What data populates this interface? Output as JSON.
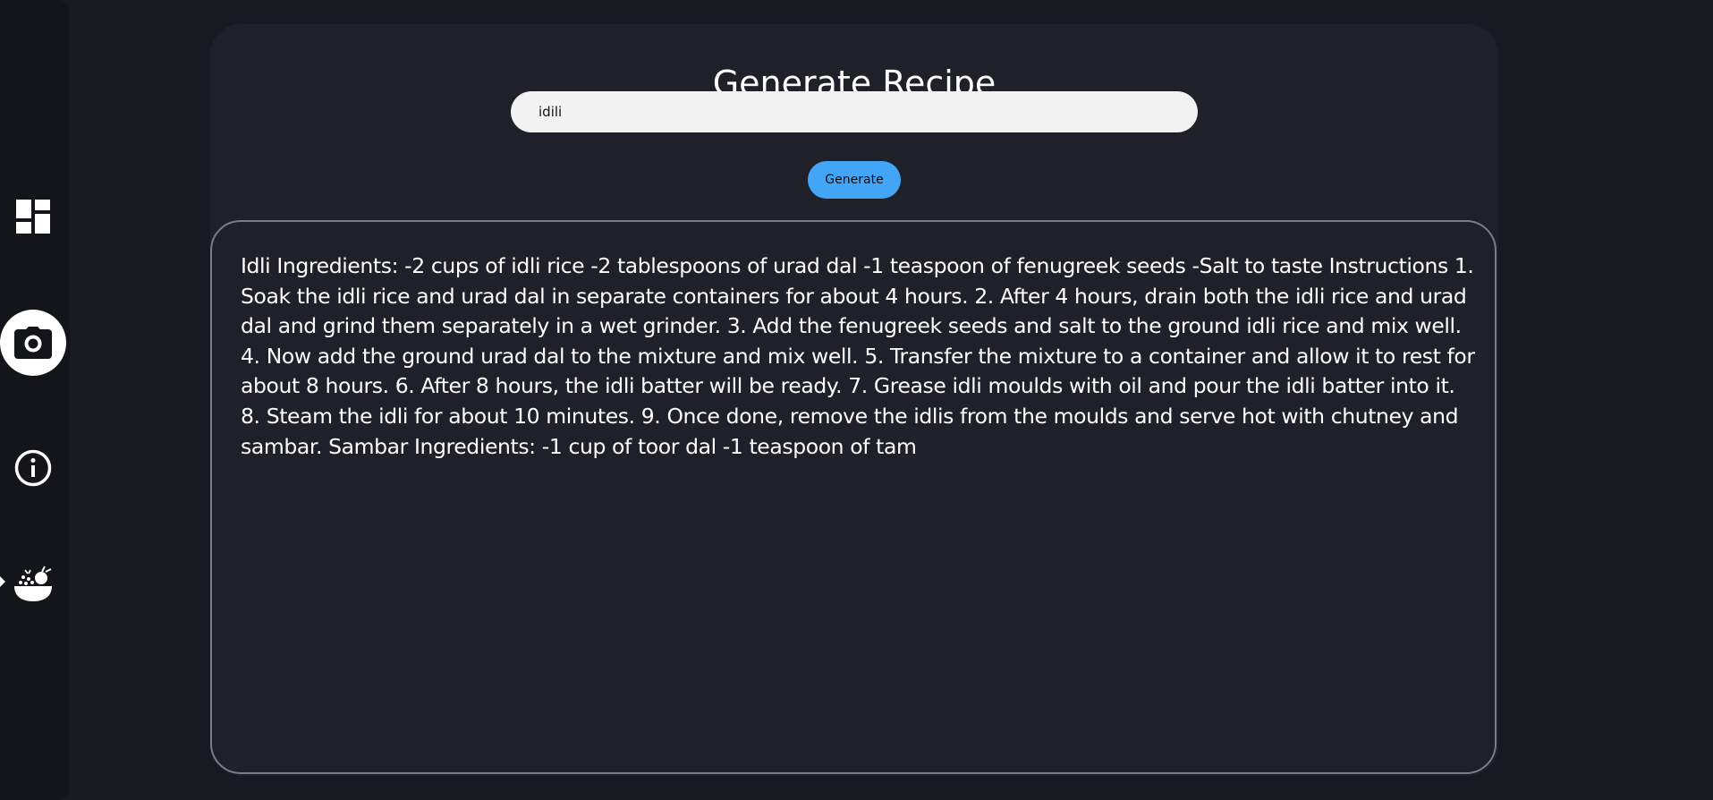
{
  "sidebar": {
    "items": [
      {
        "icon": "dashboard-icon",
        "active": false
      },
      {
        "icon": "camera-icon",
        "active": true
      },
      {
        "icon": "info-icon",
        "active": false
      },
      {
        "icon": "food-bowl-icon",
        "active": false
      }
    ]
  },
  "main": {
    "title": "Generate Recipe",
    "search": {
      "value": "idili",
      "placeholder": ""
    },
    "generate_label": "Generate",
    "result": "Idli Ingredients: -2 cups of idli rice -2 tablespoons of urad dal -1 teaspoon of fenugreek seeds -Salt to taste Instructions 1. Soak the idli rice and urad dal in separate containers for about 4 hours. 2. After 4 hours, drain both the idli rice and urad dal and grind them separately in a wet grinder. 3. Add the fenugreek seeds and salt to the ground idli rice and mix well. 4. Now add the ground urad dal to the mixture and mix well. 5. Transfer the mixture to a container and allow it to rest for about 8 hours. 6. After 8 hours, the idli batter will be ready. 7. Grease idli moulds with oil and pour the idli batter into it. 8. Steam the idli for about 10 minutes. 9. Once done, remove the idlis from the moulds and serve hot with chutney and sambar. Sambar Ingredients: -1 cup of toor dal -1 teaspoon of tam"
  },
  "colors": {
    "background": "#191922",
    "sidebar": "#14141b",
    "panel": "#1f2029",
    "accent": "#42a5f5",
    "border": "#7b7c85"
  }
}
